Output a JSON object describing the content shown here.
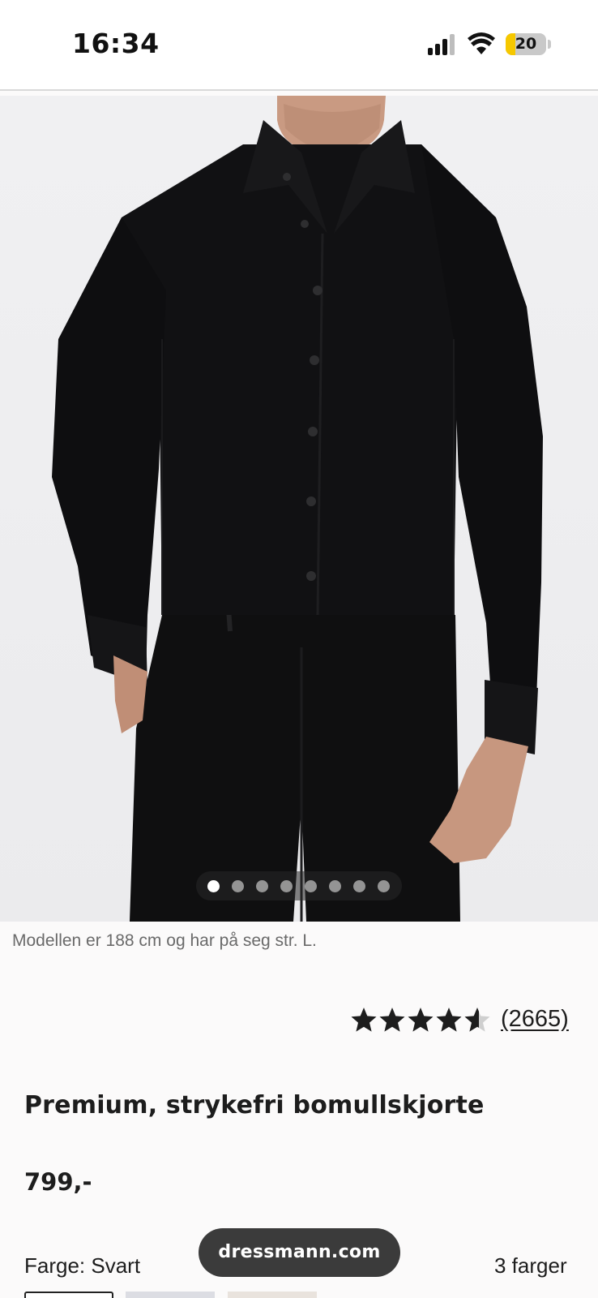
{
  "status_bar": {
    "time": "16:34",
    "battery_level": "20",
    "battery_color": "#f6c800",
    "icons": [
      "signal-icon",
      "wifi-icon",
      "battery-icon"
    ]
  },
  "product": {
    "image_description_icon": "product-photo",
    "carousel": {
      "total": 8,
      "active_index": 0
    },
    "model_note": "Modellen er 188 cm og har på seg str. L.",
    "rating": {
      "stars": 4.5,
      "max": 5,
      "review_count": "(2665)"
    },
    "title": "Premium, strykefri bomullskjorte",
    "price": "799,-",
    "color_label": "Farge: Svart",
    "color_count": "3 farger",
    "swatch_colors": [
      "#ffffff",
      "#dcdde3",
      "#e9e3dd"
    ]
  },
  "browser": {
    "url": "dressmann.com"
  }
}
